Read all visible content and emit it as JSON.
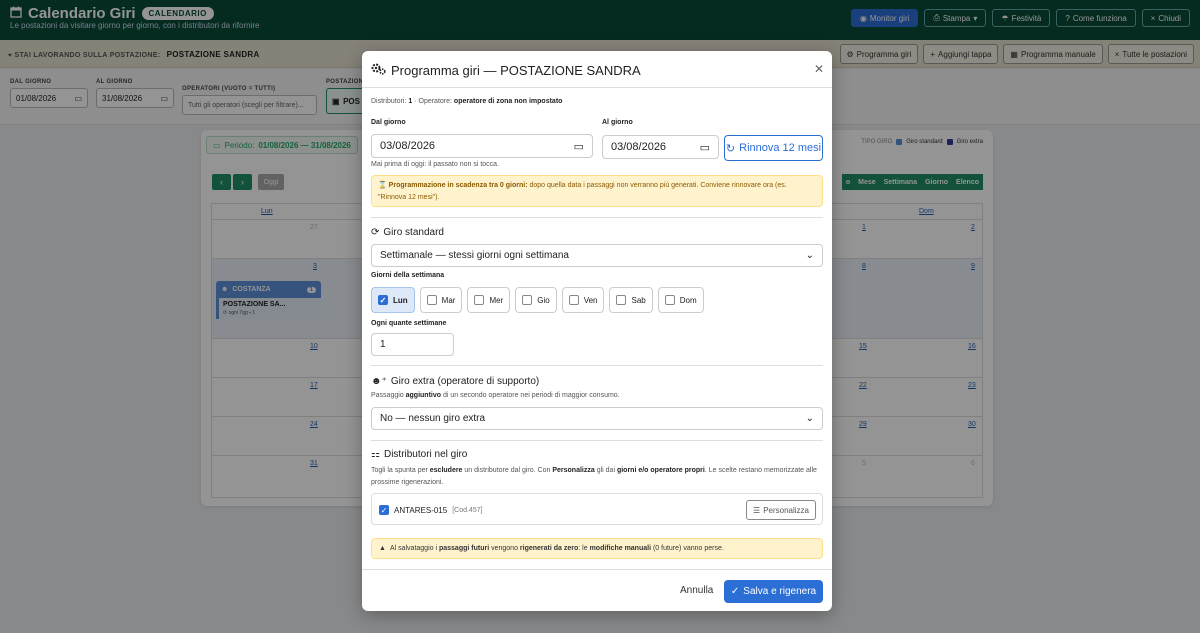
{
  "header": {
    "title": "Calendario Giri",
    "badge": "CALENDARIO",
    "subtitle": "Le postazioni da visitare giorno per giorno, con i distributori da rifornire",
    "buttons": {
      "monitor": "Monitor giri",
      "stampa": "Stampa",
      "festivita": "Festività",
      "come": "Come funziona",
      "chiudi": "Chiudi"
    }
  },
  "workstation": {
    "label": "STAI LAVORANDO SULLA POSTAZIONE:",
    "name": "POSTAZIONE SANDRA",
    "buttons": {
      "programma_giri": "Programma giri",
      "aggiungi_tappa": "Aggiungi tappa",
      "programma_manuale": "Programma manuale",
      "tutte": "Tutte le postazioni"
    }
  },
  "filters": {
    "dal_label": "DAL GIORNO",
    "dal_value": "01/08/2026",
    "al_label": "AL GIORNO",
    "al_value": "31/08/2026",
    "operatori_label": "OPERATORI (VUOTO = TUTTI)",
    "operatori_placeholder": "Tutti gli operatori (scegli per filtrare)...",
    "postazione_label": "POSTAZIONE",
    "postazione_value": "POS"
  },
  "calendar": {
    "period_label": "Periodo:",
    "period_value": "01/08/2026 — 31/08/2026",
    "today": "Oggi",
    "legend_label": "TIPO GIRO",
    "legend_standard": "Giro standard",
    "legend_extra": "Giro extra",
    "views": [
      "o",
      "Mese",
      "Settimana",
      "Giorno",
      "Elenco"
    ],
    "col_lun": "Lun",
    "col_dom": "Dom",
    "days_left": [
      "27",
      "3",
      "10",
      "17",
      "24",
      "31"
    ],
    "days_right_a": [
      "1",
      "8",
      "15",
      "22",
      "29",
      "5"
    ],
    "days_right_b": [
      "2",
      "9",
      "16",
      "23",
      "30",
      "6"
    ],
    "event": {
      "group": "COSTANZA",
      "count": "1",
      "name": "POSTAZIONE SA...",
      "meta_every": "ogni 7gg",
      "meta_count": "1"
    }
  },
  "modal": {
    "title": "Programma giri — POSTAZIONE SANDRA",
    "info_prefix": "Distributori:",
    "info_count": "1",
    "info_mid": "· Operatore:",
    "info_operator": "operatore di zona non impostato",
    "dal_label": "Dal giorno",
    "dal_value": "03/08/2026",
    "al_label": "Al giorno",
    "al_value": "03/08/2026",
    "renew": "Rinnova 12 mesi",
    "hint": "Mai prima di oggi: il passato non si tocca.",
    "warn_bold": "Programmazione in scadenza tra 0 giorni:",
    "warn_text": " dopo quella data i passaggi non verranno più generati. Conviene rinnovare ora (es. \"Rinnova 12 mesi\").",
    "std_title": "Giro standard",
    "std_select": "Settimanale — stessi giorni ogni settimana",
    "days_label": "Giorni della settimana",
    "days": [
      {
        "label": "Lun",
        "checked": true
      },
      {
        "label": "Mar",
        "checked": false
      },
      {
        "label": "Mer",
        "checked": false
      },
      {
        "label": "Gio",
        "checked": false
      },
      {
        "label": "Ven",
        "checked": false
      },
      {
        "label": "Sab",
        "checked": false
      },
      {
        "label": "Dom",
        "checked": false
      }
    ],
    "weeks_label": "Ogni quante settimane",
    "weeks_value": "1",
    "extra_title": "Giro extra (operatore di supporto)",
    "extra_desc_a": "Passaggio ",
    "extra_desc_b": "aggiuntivo",
    "extra_desc_c": " di un secondo operatore nei periodi di maggior consumo.",
    "extra_select": "No — nessun giro extra",
    "dist_title": "Distributori nel giro",
    "dist_desc_a": "Togli la spunta per ",
    "dist_desc_b": "escludere",
    "dist_desc_c": " un distributore dal giro. Con ",
    "dist_desc_d": "Personalizza",
    "dist_desc_e": " gli dai ",
    "dist_desc_f": "giorni e/o operatore propri",
    "dist_desc_g": ". Le scelte restano memorizzate alle prossime rigenerazioni.",
    "dist_name": "ANTARES-015",
    "dist_code": "[Cod.457]",
    "personalizza": "Personalizza",
    "notice_a": "Al salvataggio i ",
    "notice_b": "passaggi futuri",
    "notice_c": " vengono ",
    "notice_d": "rigenerati da zero",
    "notice_e": ": le ",
    "notice_f": "modifiche manuali",
    "notice_g": " (0 future) vanno perse.",
    "cancel": "Annulla",
    "save": "Salva e rigenera"
  },
  "colors": {
    "header_bg": "#0a4a3a",
    "accent": "#2b6fd6",
    "calendar_green": "#1f8e66",
    "warning_bg": "#fff3cd"
  }
}
